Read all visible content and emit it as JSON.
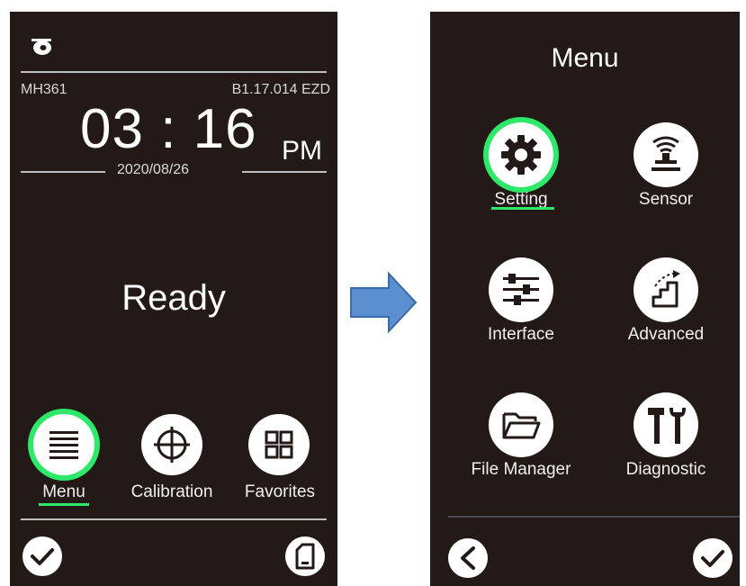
{
  "home": {
    "model": "MH361",
    "firmware": "B1.17.014 EZD",
    "time": "03 : 16",
    "ampm": "PM",
    "date": "2020/08/26",
    "status": "Ready",
    "shortcuts": [
      {
        "label": "Menu",
        "icon": "menu-icon",
        "selected": true
      },
      {
        "label": "Calibration",
        "icon": "crosshair-icon",
        "selected": false
      },
      {
        "label": "Favorites",
        "icon": "grid-icon",
        "selected": false
      }
    ],
    "bottom": {
      "left_icon": "check-icon",
      "right_icon": "phone-document-icon"
    }
  },
  "menu": {
    "title": "Menu",
    "items": [
      {
        "label": "Setting",
        "icon": "gear-icon",
        "selected": true
      },
      {
        "label": "Sensor",
        "icon": "sensor-icon",
        "selected": false
      },
      {
        "label": "Interface",
        "icon": "sliders-icon",
        "selected": false
      },
      {
        "label": "Advanced",
        "icon": "stairs-icon",
        "selected": false
      },
      {
        "label": "File Manager",
        "icon": "folder-icon",
        "selected": false
      },
      {
        "label": "Diagnostic",
        "icon": "tools-icon",
        "selected": false
      }
    ],
    "bottom": {
      "left_icon": "back-icon",
      "right_icon": "check-icon"
    }
  },
  "colors": {
    "screen_bg": "#231a17",
    "selection": "#2ee86a",
    "arrow_fill": "#5b8fd0",
    "arrow_stroke": "#3a6aa8"
  }
}
